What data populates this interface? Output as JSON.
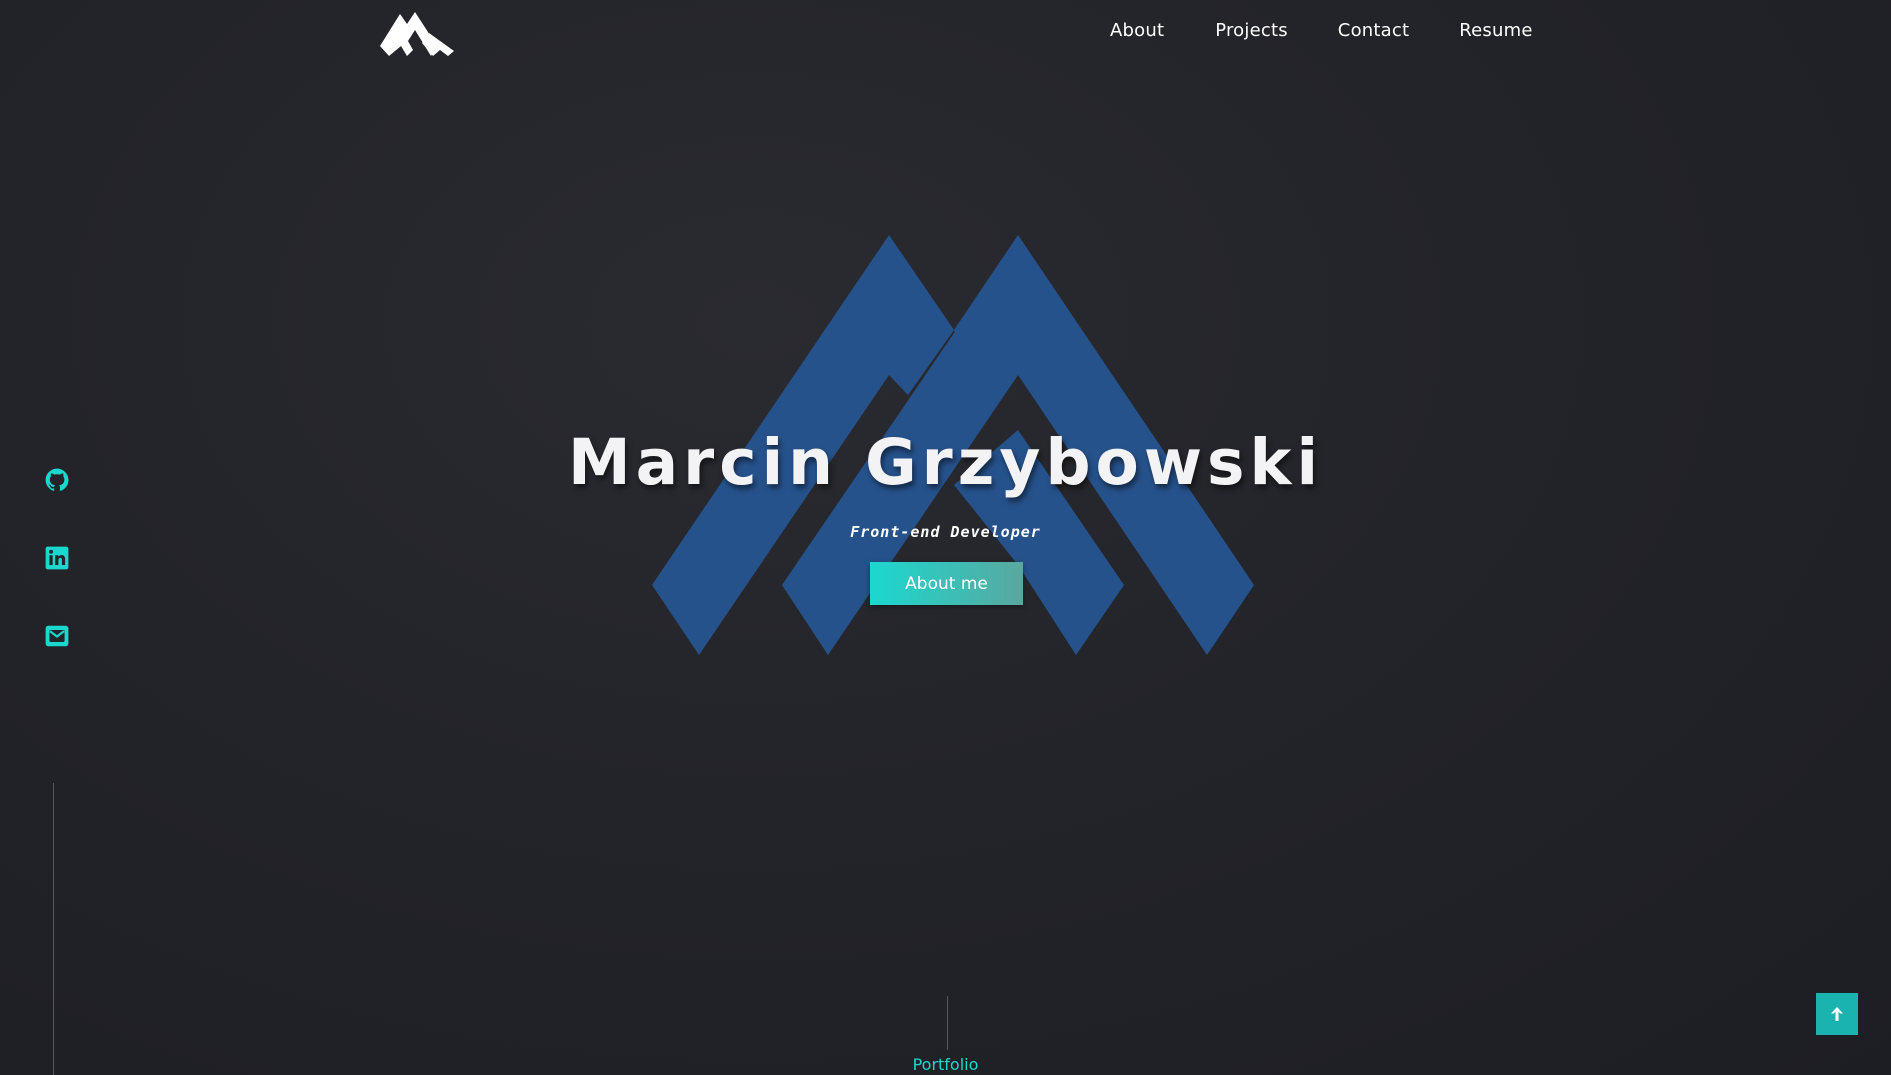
{
  "nav": {
    "items": [
      {
        "label": "About"
      },
      {
        "label": "Projects"
      },
      {
        "label": "Contact"
      },
      {
        "label": "Resume"
      }
    ]
  },
  "hero": {
    "title": "Marcin Grzybowski",
    "subtitle": "Front-end Developer",
    "cta_label": "About me"
  },
  "social": {
    "icons": [
      "github-icon",
      "linkedin-icon",
      "email-icon"
    ]
  },
  "portfolio_label": "Portfolio",
  "colors": {
    "accent": "#1bd8cf",
    "hero_mark": "#26528c",
    "background": "#232429"
  }
}
